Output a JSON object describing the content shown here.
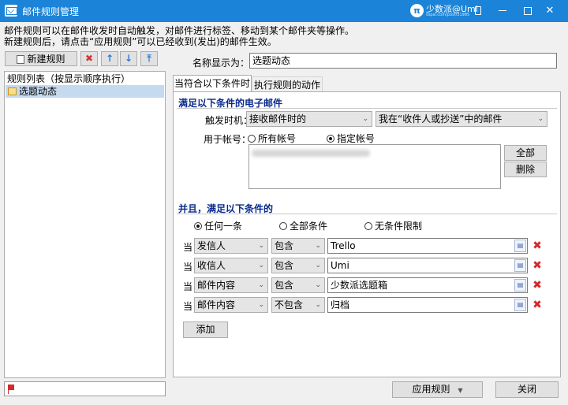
{
  "window": {
    "title": "邮件规则管理"
  },
  "watermark": {
    "brand": "少数派@Umi",
    "url": "sspai.com/post/31985"
  },
  "description": {
    "line1": "邮件规则可以在邮件收发时自动触发，对邮件进行标签、移动到某个邮件夹等操作。",
    "line2": "新建规则后，请点击“应用规则”可以已经收到(发出)的邮件生效。"
  },
  "toolbar": {
    "new_rule_label": "新建规则",
    "delete_glyph": "✖",
    "up_glyph": "↑",
    "down_glyph": "↓",
    "top_glyph": "⤒"
  },
  "rule_list": {
    "header": "规则列表（按显示顺序执行）",
    "items": [
      {
        "label": "选题动态"
      }
    ]
  },
  "name_field": {
    "label": "名称显示为：",
    "value": "选题动态"
  },
  "tabs": [
    {
      "label": "当符合以下条件时"
    },
    {
      "label": "执行规则的动作"
    }
  ],
  "conditions": {
    "section_title": "满足以下条件的电子邮件",
    "trigger_label": "触发时机：",
    "trigger_value": "接收邮件时的",
    "recipient_value": "我在“收件人或抄送”中的邮件",
    "account_label": "用于帐号：",
    "account_all_label": "所有帐号",
    "account_specific_label": "指定帐号",
    "select_all_label": "全部",
    "delete_label": "删除"
  },
  "and_section": {
    "title": "并且，满足以下条件的",
    "any_label": "任何一条",
    "all_label": "全部条件",
    "none_label": "无条件限制",
    "rows": [
      {
        "prefix": "当",
        "field": "发信人",
        "op": "包含",
        "value": "Trello"
      },
      {
        "prefix": "当",
        "field": "收信人",
        "op": "包含",
        "value": "Umi"
      },
      {
        "prefix": "当",
        "field": "邮件内容",
        "op": "包含",
        "value": "少数派选题箱"
      },
      {
        "prefix": "当",
        "field": "邮件内容",
        "op": "不包含",
        "value": "归档"
      }
    ],
    "add_label": "添加"
  },
  "footer": {
    "apply_label": "应用规则",
    "close_label": "关闭"
  },
  "colors": {
    "titlebar": "#1b84d8",
    "section": "#0a2a8c",
    "selected_row": "#c5d9ef",
    "delete_red": "#d12c2c"
  }
}
